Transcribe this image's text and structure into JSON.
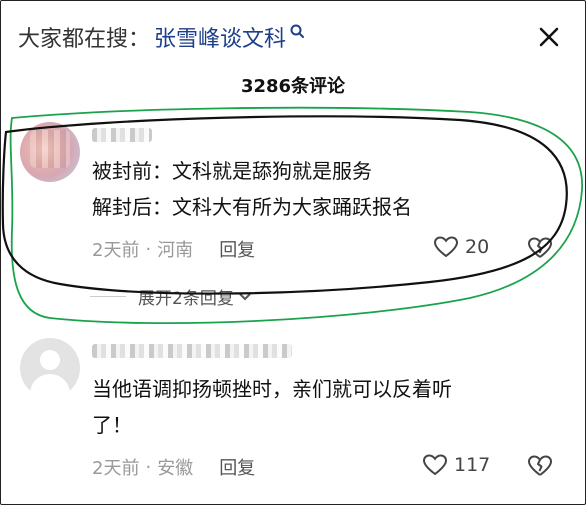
{
  "header": {
    "search_prefix": "大家都在搜：",
    "search_term": "张雪峰谈文科",
    "comment_count": "3286条评论"
  },
  "comments": [
    {
      "line1": "被封前：文科就是舔狗就是服务",
      "line2": "解封后：文科大有所为大家踊跃报名",
      "time": "2天前",
      "location": "河南",
      "reply_label": "回复",
      "likes": "20",
      "expand_label": "展开2条回复"
    },
    {
      "line1": "当他语调抑扬顿挫时，亲们就可以反着听",
      "line2": "了！",
      "time": "2天前",
      "location": "安徽",
      "reply_label": "回复",
      "likes": "117"
    }
  ],
  "colors": {
    "annotation_black": "#111111",
    "annotation_green": "#1aa34a",
    "link_blue": "#1d3f8a"
  }
}
